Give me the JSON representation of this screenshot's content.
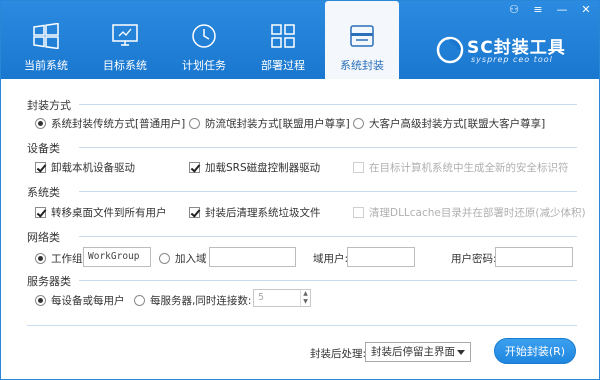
{
  "window": {
    "controls": {
      "user": "⚇",
      "menu": "≡",
      "minimize": "—",
      "close": "✕"
    }
  },
  "tabs": [
    {
      "label": "当前系统",
      "icon": "windows-icon"
    },
    {
      "label": "目标系统",
      "icon": "monitor-icon"
    },
    {
      "label": "计划任务",
      "icon": "clock-icon"
    },
    {
      "label": "部署过程",
      "icon": "grid-icon"
    },
    {
      "label": "系统封装",
      "icon": "package-icon",
      "active": true
    }
  ],
  "brand": {
    "title": "SC封装工具",
    "subtitle": "sysprep ceo tool"
  },
  "sections": {
    "mode": {
      "title": "封装方式",
      "options": [
        {
          "label": "系统封装传统方式[普通用户]",
          "checked": true
        },
        {
          "label": "防流氓封装方式[联盟用户尊享]",
          "checked": false
        },
        {
          "label": "大客户高级封装方式[联盟大客户尊享]",
          "checked": false
        }
      ]
    },
    "device": {
      "title": "设备类",
      "options": [
        {
          "label": "卸载本机设备驱动",
          "checked": true
        },
        {
          "label": "加载SRS磁盘控制器驱动",
          "checked": true
        },
        {
          "label": "在目标计算机系统中生成全新的安全标识符",
          "checked": false,
          "disabled": true
        }
      ]
    },
    "system": {
      "title": "系统类",
      "options": [
        {
          "label": "转移桌面文件到所有用户",
          "checked": true
        },
        {
          "label": "封装后清理系统垃圾文件",
          "checked": true
        },
        {
          "label": "清理DLLcache目录并在部署时还原(减少体积)",
          "checked": false,
          "disabled": true
        }
      ]
    },
    "network": {
      "title": "网络类",
      "workgroup_label": "工作组",
      "workgroup_value": "WorkGroup",
      "domain_label": "加入域",
      "domain_value": "",
      "domain_user_label": "域用户:",
      "domain_user_value": "",
      "user_password_label": "用户密码:",
      "user_password_value": ""
    },
    "server": {
      "title": "服务器类",
      "per_device_label": "每设备或每用户",
      "per_server_label": "每服务器,同时连接数:",
      "connections": "5"
    }
  },
  "footer": {
    "after_label": "封装后处理:",
    "after_value": "封装后停留主界面",
    "start_label": "开始封装(R)"
  }
}
